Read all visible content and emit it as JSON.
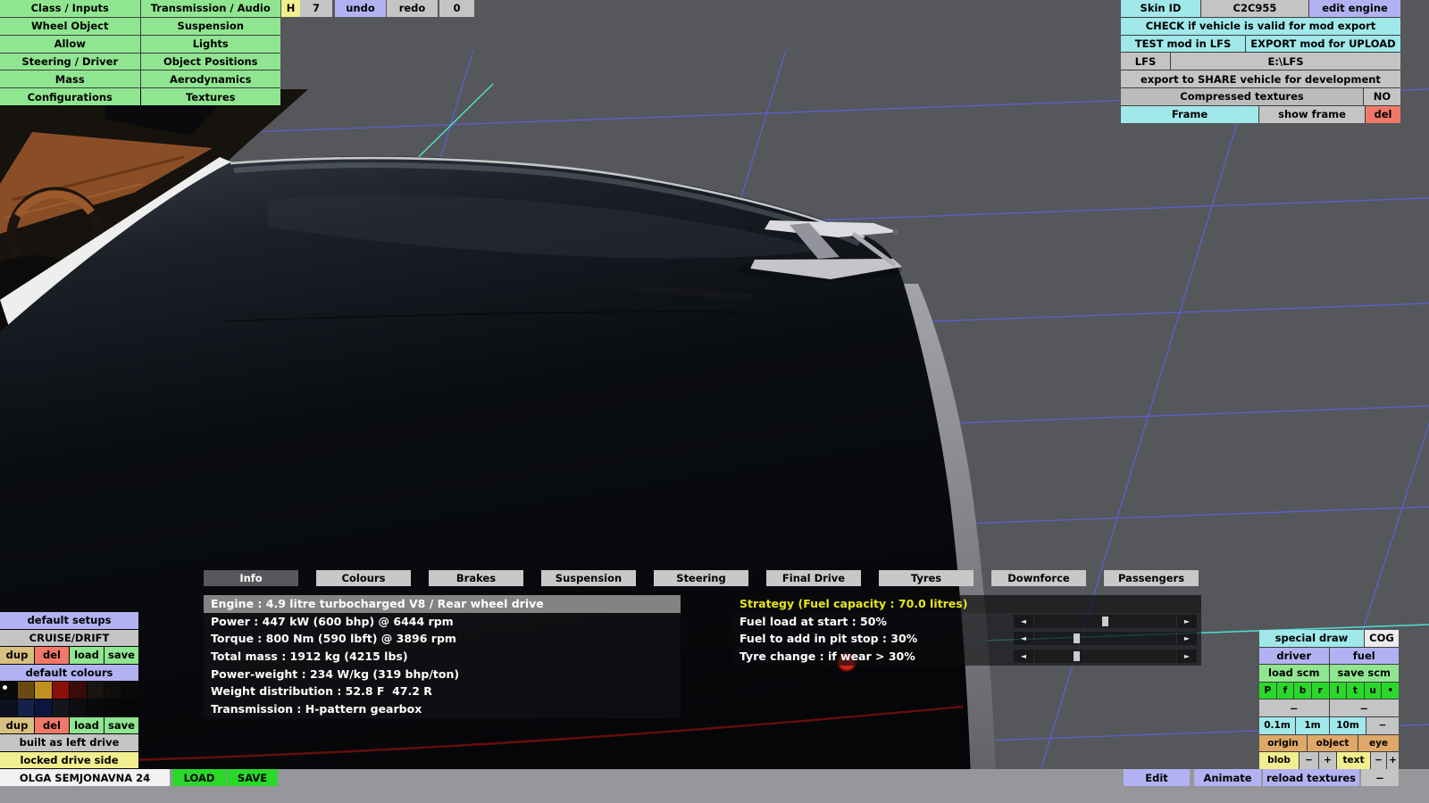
{
  "menu": {
    "items": [
      "Class / Inputs",
      "Transmission / Audio",
      "Wheel Object",
      "Suspension",
      "Allow",
      "Lights",
      "Steering / Driver",
      "Object Positions",
      "Mass",
      "Aerodynamics",
      "Configurations",
      "Textures"
    ]
  },
  "topbar": {
    "history_mode": "H",
    "history_count": "7",
    "undo": "undo",
    "redo": "redo",
    "zero": "0"
  },
  "export_panel": {
    "skin_id_label": "Skin ID",
    "skin_id_value": "C2C955",
    "edit_engine": "edit engine",
    "check": "CHECK if vehicle is valid for mod export",
    "test": "TEST mod in LFS",
    "export_upload": "EXPORT mod for UPLOAD",
    "lfs_label": "LFS",
    "lfs_path": "E:\\LFS",
    "share": "export to SHARE vehicle for development",
    "compressed_label": "Compressed textures",
    "compressed_value": "NO",
    "frame": "Frame",
    "show_frame": "show frame",
    "frame_del": "del"
  },
  "tabs": {
    "items": [
      "Info",
      "Colours",
      "Brakes",
      "Suspension",
      "Steering",
      "Final Drive",
      "Tyres",
      "Downforce",
      "Passengers"
    ],
    "selected": "Info"
  },
  "info": {
    "lines": [
      "Engine : 4.9 litre turbocharged V8 / Rear wheel drive",
      "Power : 447 kW (600 bhp) @ 6444 rpm",
      "Torque : 800 Nm (590 lbft) @ 3896 rpm",
      "Total mass : 1912 kg (4215 lbs)",
      "Power-weight : 234 W/kg (319 bhp/ton)",
      "Weight distribution : 52.8 F  47.2 R",
      "Transmission : H-pattern gearbox"
    ]
  },
  "strategy": {
    "title": "Strategy (Fuel capacity : 70.0 litres)",
    "left_arrow": "◄",
    "right_arrow": "►",
    "sliders": [
      {
        "label": "Fuel load at start : 50%",
        "percent": 50
      },
      {
        "label": "Fuel to add in pit stop : 30%",
        "percent": 30
      },
      {
        "label": "Tyre change : if wear > 30%",
        "percent": 30
      }
    ]
  },
  "setups_panel": {
    "default_setups": "default setups",
    "setup_name": "CRUISE/DRIFT",
    "dup": "dup",
    "del": "del",
    "load": "load",
    "save": "save",
    "default_colours": "default colours",
    "swatches_row1": [
      "#0a0a0a",
      "#6b4a12",
      "#c09020",
      "#8a1008",
      "#3a0c08",
      "#181410",
      "#100e0c",
      "#0c0a08"
    ],
    "swatches_row2": [
      "#0c1020",
      "#16214a",
      "#0e1440",
      "#14161c",
      "#0e0e10",
      "#0a0a0c",
      "#080808",
      "#060606"
    ],
    "built": "built as left drive",
    "locked": "locked drive side"
  },
  "bottom_bar": {
    "vehicle_name": "OLGA SEMJONAVNA 24",
    "load": "LOAD",
    "save": "SAVE",
    "edit": "Edit",
    "animate": "Animate",
    "reload_textures": "reload textures",
    "minus": "−"
  },
  "view_panel": {
    "special_draw": "special draw",
    "cog": "COG",
    "driver": "driver",
    "fuel": "fuel",
    "load_scm": "load scm",
    "save_scm": "save scm",
    "letters": [
      "P",
      "f",
      "b",
      "r",
      "l",
      "t",
      "u",
      "•"
    ],
    "dash1": "−",
    "dash2": "−",
    "m01": "0.1m",
    "m1": "1m",
    "m10": "10m",
    "mdash": "−",
    "origin": "origin",
    "object": "object",
    "eye": "eye",
    "blob": "blob",
    "blob_minus": "−",
    "blob_plus": "+",
    "text": "text",
    "text_minus": "−",
    "text_plus": "+"
  }
}
